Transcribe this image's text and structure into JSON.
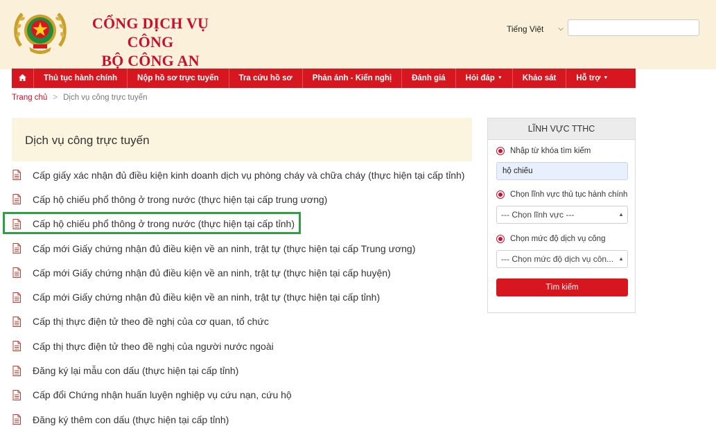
{
  "header": {
    "title_line1": "CỔNG DỊCH VỤ CÔNG",
    "title_line2": "BỘ CÔNG AN",
    "language_selected": "Tiếng Việt",
    "search_value": ""
  },
  "nav": {
    "items": [
      {
        "label": "Thủ tục hành chính"
      },
      {
        "label": "Nộp hồ sơ trực tuyến"
      },
      {
        "label": "Tra cứu hồ sơ"
      },
      {
        "label": "Phản ánh - Kiến nghị"
      },
      {
        "label": "Đánh giá"
      },
      {
        "label": "Hỏi đáp"
      },
      {
        "label": "Khảo sát"
      },
      {
        "label": "Hỗ trợ"
      }
    ]
  },
  "breadcrumb": {
    "home": "Trang chủ",
    "current": "Dịch vụ công trực tuyến"
  },
  "main": {
    "title": "Dịch vụ công trực tuyến",
    "services": [
      "Cấp giấy xác nhận đủ điều kiện kinh doanh dịch vụ phòng cháy và chữa cháy (thực hiện tại cấp tỉnh)",
      "Cấp hộ chiếu phổ thông ở trong nước (thực hiện tại cấp trung ương)",
      "Cấp hộ chiếu phổ thông ở trong nước (thực hiện tại cấp tỉnh)",
      "Cấp mới Giấy chứng nhận đủ điều kiện về an ninh, trật tự (thực hiện tại cấp Trung ương)",
      "Cấp mới Giấy chứng nhận đủ điều kiện về an ninh, trật tự (thực hiện tại cấp huyện)",
      "Cấp mới Giấy chứng nhận đủ điều kiện về an ninh, trật tự (thực hiện tại cấp tỉnh)",
      "Cấp thị thực điện tử theo đề nghị của cơ quan, tổ chức",
      "Cấp thị thực điện tử theo đề nghị của người nước ngoài",
      "Đăng ký lại mẫu con dấu (thực hiện tại cấp tỉnh)",
      "Cấp đổi Chứng nhận huấn luyện nghiệp vụ cứu nạn, cứu hộ",
      "Đăng ký thêm con dấu (thực hiện tại cấp tỉnh)"
    ]
  },
  "sidebar": {
    "title": "LĨNH VỰC TTHC",
    "keyword_label": "Nhập từ khóa tìm kiếm",
    "keyword_value": "hộ chiếu",
    "field_label": "Chọn lĩnh vực thủ tục hành chính",
    "field_selected": "--- Chọn lĩnh vực ---",
    "level_label": "Chọn mức độ dịch vụ công",
    "level_selected": "--- Chọn mức độ dịch vụ côn...",
    "search_button": "Tìm kiếm"
  },
  "colors": {
    "brand_red": "#d7171f",
    "header_bg": "#fbf1da",
    "highlight_green": "#2ea043"
  }
}
